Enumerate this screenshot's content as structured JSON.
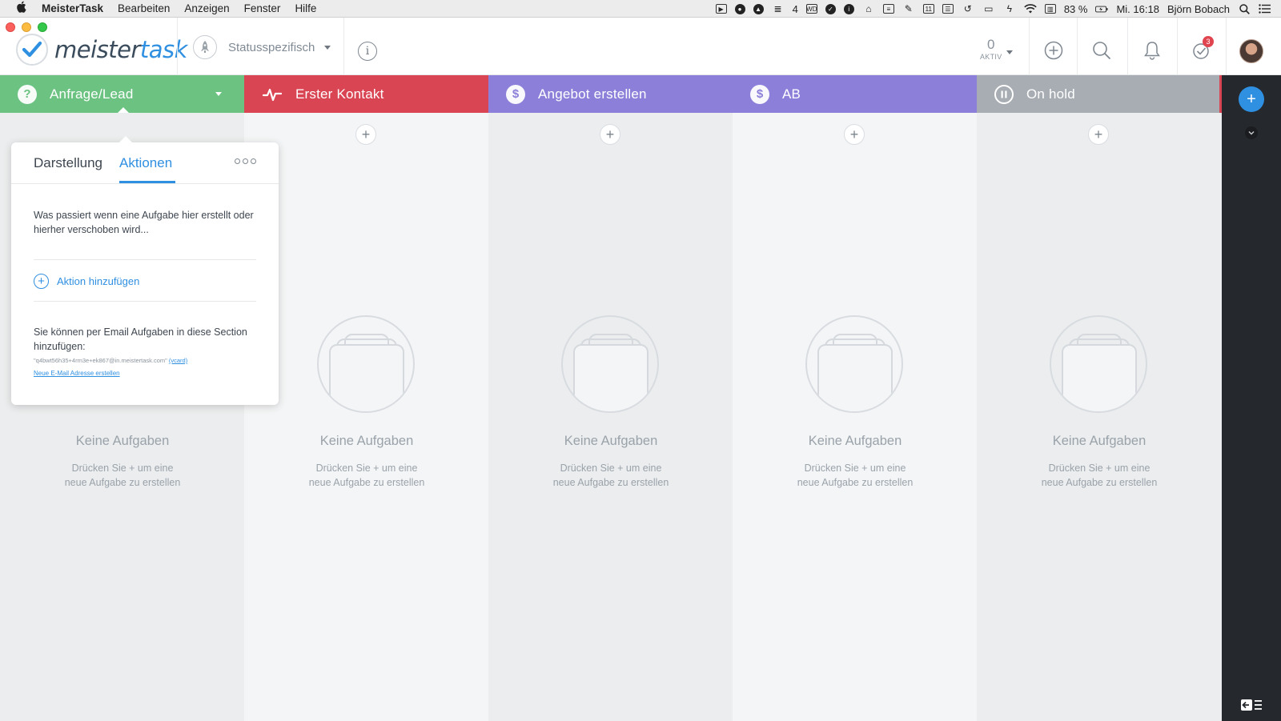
{
  "menubar": {
    "apple": "",
    "items": [
      "MeisterTask",
      "Bearbeiten",
      "Anzeigen",
      "Fenster",
      "Hilfe"
    ],
    "tray_badge_count": "4",
    "battery": "83 %",
    "clock": "Mi. 16:18",
    "user": "Björn Bobach"
  },
  "topbar": {
    "logo_meister": "meister",
    "logo_task": "task",
    "status_filter": "Statusspezifisch",
    "aktiv_count": "0",
    "aktiv_label": "AKTIV",
    "notifications_badge": "3"
  },
  "sections": [
    {
      "title": "Anfrage/Lead",
      "icon": "question-icon",
      "color": "#6bc281"
    },
    {
      "title": "Erster Kontakt",
      "icon": "activity-icon",
      "color": "#d94553"
    },
    {
      "title": "Angebot erstellen",
      "icon": "dollar-icon",
      "color": "#8b7fd9"
    },
    {
      "title": "AB",
      "icon": "dollar-icon",
      "color": "#8b7fd9"
    },
    {
      "title": "On hold",
      "icon": "pause-icon",
      "color": "#a7adb3"
    }
  ],
  "empty_state": {
    "title": "Keine Aufgaben",
    "subtitle_line1": "Drücken Sie + um eine",
    "subtitle_line2": "neue Aufgabe zu erstellen"
  },
  "popover": {
    "tab_display": "Darstellung",
    "tab_actions": "Aktionen",
    "description": "Was passiert wenn eine Aufgabe hier erstellt oder hierher verschoben wird...",
    "add_action": "Aktion hinzufügen",
    "email_text": "Sie können per Email Aufgaben in diese Section hinzufügen:",
    "email_address": "\"q4bwt56h35+4rm3e+ek867@in.meistertask.com\"",
    "vcard_link": "(vcard)",
    "new_email_link": "Neue E-Mail Adresse erstellen"
  },
  "colors": {
    "accent": "#2f8fe0",
    "rail": "#25282c",
    "column_light": "#f4f5f6",
    "column_dark": "#ebedee"
  }
}
